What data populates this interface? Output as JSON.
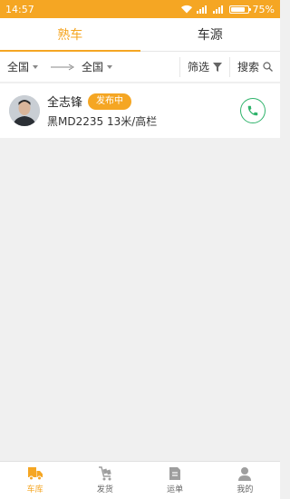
{
  "status_bar": {
    "time": "14:57",
    "battery": "75%",
    "battery_level": 0.75
  },
  "tabs": [
    {
      "label": "熟车",
      "active": true
    },
    {
      "label": "车源",
      "active": false
    }
  ],
  "filters": {
    "origin": "全国",
    "destination": "全国",
    "filter_label": "筛选",
    "search_label": "搜索"
  },
  "list": [
    {
      "name": "全志锋",
      "status": "发布中",
      "truck_info": "黑MD2235 13米/高栏"
    }
  ],
  "nav": [
    {
      "label": "车库",
      "icon": "truck-icon",
      "active": true
    },
    {
      "label": "发货",
      "icon": "cart-icon",
      "active": false
    },
    {
      "label": "运单",
      "icon": "waybill-icon",
      "active": false
    },
    {
      "label": "我的",
      "icon": "user-icon",
      "active": false
    }
  ],
  "colors": {
    "accent": "#f5a623",
    "phone": "#2fb36b",
    "inactive": "#9e9e9e"
  }
}
